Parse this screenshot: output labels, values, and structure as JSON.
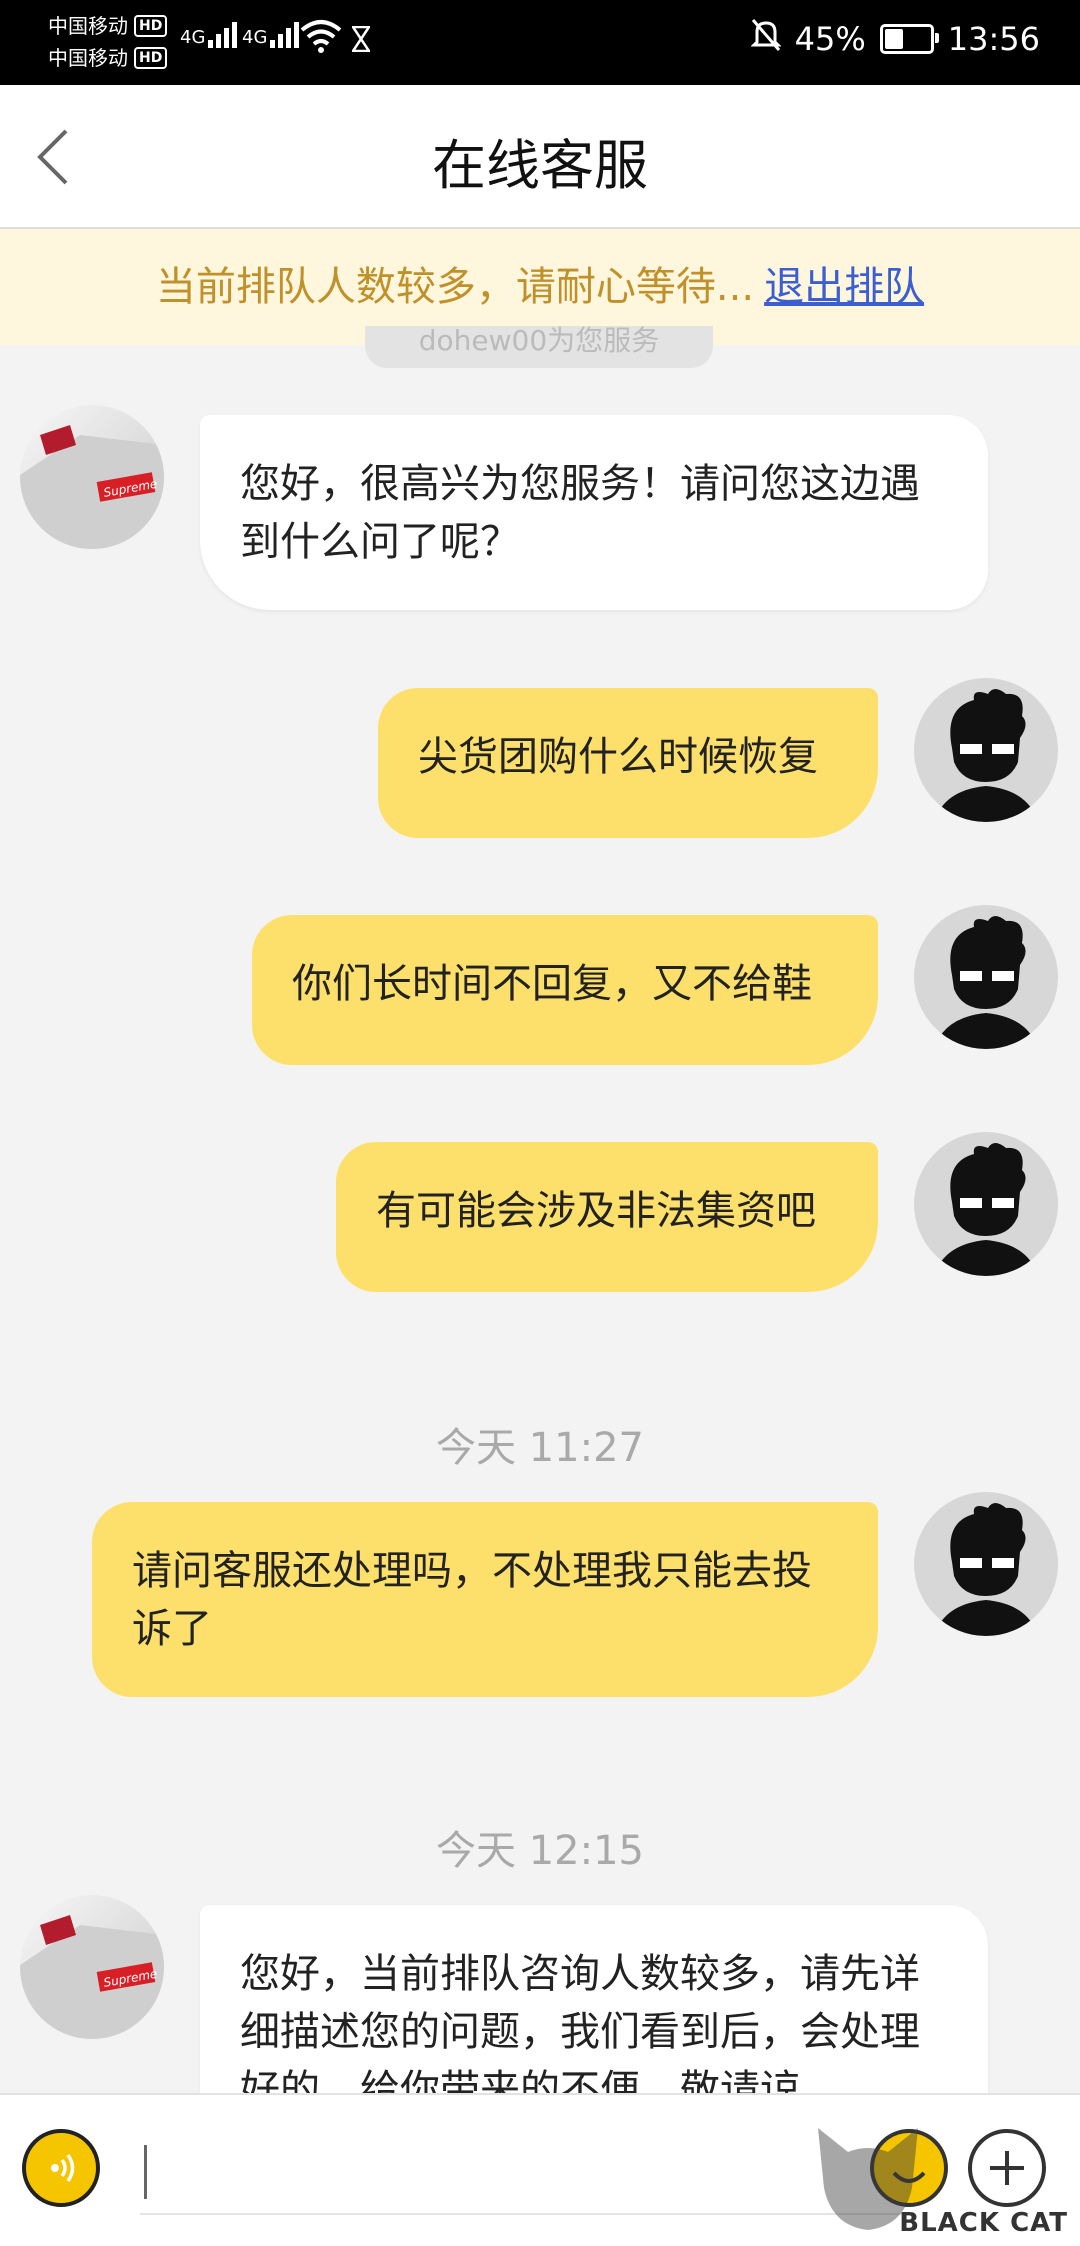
{
  "status_bar": {
    "carrier1": "中国移动",
    "carrier2": "中国移动",
    "hd": "HD",
    "net1": "4G",
    "net2": "4G",
    "battery_percent": "45%",
    "battery_level": 0.45,
    "time": "13:56"
  },
  "header": {
    "title": "在线客服"
  },
  "banner": {
    "text": "当前排队人数较多，请耐心等待...",
    "exit_link": "退出排队"
  },
  "ghost_pill_text": "dohew00为您服务",
  "messages": [
    {
      "from": "agent",
      "text": "您好，很高兴为您服务！请问您这边遇到什么问了呢？"
    },
    {
      "from": "user",
      "text": "尖货团购什么时候恢复"
    },
    {
      "from": "user",
      "text": "你们长时间不回复，又不给鞋"
    },
    {
      "from": "user",
      "text": "有可能会涉及非法集资吧"
    },
    {
      "from": "user",
      "text": "请问客服还处理吗，不处理我只能去投诉了"
    },
    {
      "from": "agent",
      "text": "您好，当前排队咨询人数较多，请先详细描述您的问题，我们看到后，会处理好的，给你带来的不便，敬请谅"
    }
  ],
  "timestamps": [
    "今天 11:27",
    "今天 12:15"
  ],
  "agent_avatar_label": "Supreme",
  "input": {
    "placeholder": ""
  },
  "watermark": {
    "text": "BLACK CAT"
  }
}
